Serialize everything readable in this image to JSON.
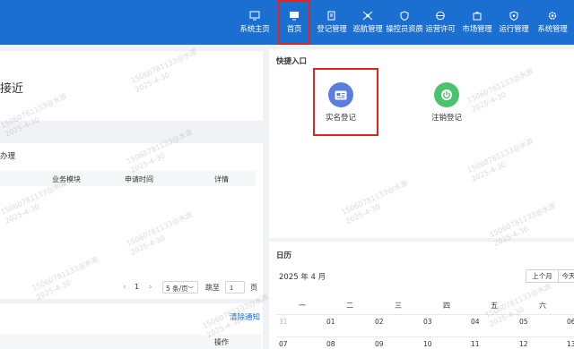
{
  "nav": {
    "items": [
      {
        "label": "系统主页",
        "icon": "monitor-icon"
      },
      {
        "label": "首页",
        "icon": "screen-icon",
        "active": true
      },
      {
        "label": "登记管理",
        "icon": "doc-edit-icon"
      },
      {
        "label": "巡航管理",
        "icon": "drone-icon"
      },
      {
        "label": "操控员资质",
        "icon": "shield-icon"
      },
      {
        "label": "运营许可",
        "icon": "globe-icon"
      },
      {
        "label": "市场管理",
        "icon": "bag-icon"
      },
      {
        "label": "运行管理",
        "icon": "gear-shield-icon"
      },
      {
        "label": "系统管理",
        "icon": "cog-icon"
      }
    ]
  },
  "welcome": {
    "text": "接近"
  },
  "todo": {
    "title": "办理",
    "columns": [
      "业务模块",
      "申请时间",
      "详情"
    ]
  },
  "pagination": {
    "prev": "‹",
    "page": "1",
    "next": "›",
    "page_size": "5 条/页",
    "goto_label": "跳至",
    "goto_value": "1",
    "page_suffix": "页"
  },
  "notices": {
    "clear_label": "清除通知",
    "op_column": "操作"
  },
  "quick_entry": {
    "title": "快捷入口",
    "items": [
      {
        "label": "实名登记",
        "icon": "id-card-icon",
        "color": "#5a7ee0"
      },
      {
        "label": "注销登记",
        "icon": "power-icon",
        "color": "#4cc26e"
      }
    ]
  },
  "calendar": {
    "title": "日历",
    "month": "2025 年 4 月",
    "prev_month": "上个月",
    "today": "今天",
    "weekdays": [
      "一",
      "二",
      "三",
      "四",
      "五",
      "六"
    ],
    "rows": [
      [
        "31",
        "01",
        "02",
        "03",
        "04",
        "05",
        "06"
      ],
      [
        "07",
        "08",
        "09",
        "10",
        "11",
        "12",
        "13"
      ]
    ]
  },
  "watermark": {
    "line1": "15060781133@水波",
    "line2": "2025-4-30"
  },
  "colors": {
    "topbar": "#1a6fd1",
    "highlight": "#e0241b",
    "link": "#1a6fd1"
  }
}
